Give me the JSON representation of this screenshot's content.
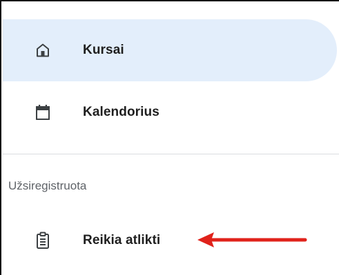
{
  "nav": {
    "items": [
      {
        "label": "Kursai",
        "icon": "home-icon",
        "active": true
      },
      {
        "label": "Kalendorius",
        "icon": "calendar-icon",
        "active": false
      }
    ]
  },
  "enrolled": {
    "section_title": "Užsiregistruota",
    "items": [
      {
        "label": "Reikia atlikti",
        "icon": "clipboard-icon"
      }
    ]
  },
  "annotation": {
    "type": "arrow",
    "color": "#e0221b",
    "points_to": "Reikia atlikti"
  },
  "colors": {
    "active_bg": "#e3eefb",
    "text": "#1f1f1f",
    "muted": "#5f6368"
  }
}
